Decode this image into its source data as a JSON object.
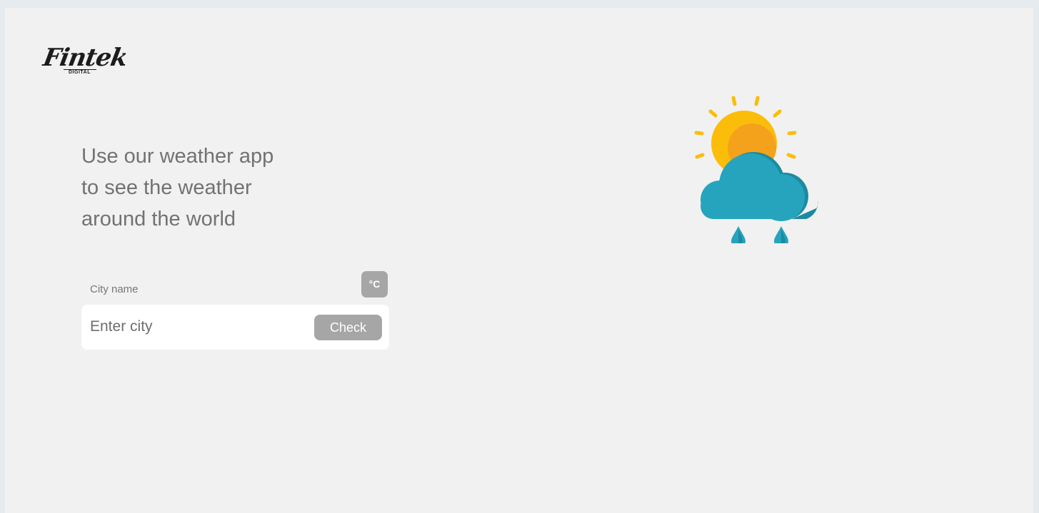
{
  "brand": {
    "logo_text": "Fintek",
    "logo_subtext": "DIGITAL"
  },
  "hero": {
    "lines": [
      "Use our weather app",
      "to see the weather",
      "around the world"
    ]
  },
  "search": {
    "label": "City name",
    "placeholder": "Enter city",
    "check_label": "Check",
    "unit_label": "°C"
  },
  "illustration": {
    "icon": "sun-cloud-rain-icon",
    "colors": {
      "sun": "#fbbd0a",
      "sun_shade": "#f4a21c",
      "cloud": "#26a4bd",
      "cloud_shade": "#1b8aa2",
      "drops": "#26a4bd"
    }
  },
  "colors": {
    "background": "#f1f1f1",
    "button": "#a6a6a6",
    "text": "#727272",
    "input_bg": "#ffffff"
  }
}
